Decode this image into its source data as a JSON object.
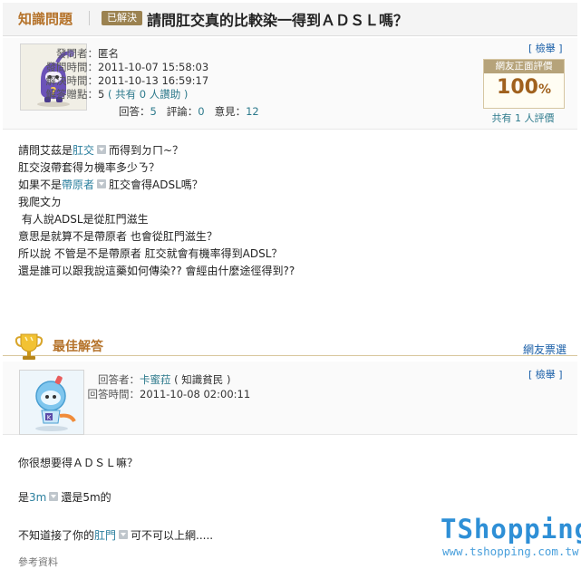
{
  "header": {
    "section": "知識問題",
    "status": "已解決",
    "title": "請問肛交真的比較染一得到ＡＤＳＬ嗎？"
  },
  "question_meta": {
    "asker_label": "發問者：",
    "asker": "匿名",
    "asked_label": "發問時間：",
    "asked": "2011-10-07 15:58:03",
    "solved_label": "解決時間：",
    "solved": "2011-10-13 16:59:17",
    "points_label": "解答贈點：",
    "points": "5",
    "points_note": "( 共有 0 人讚助 )",
    "answers_label": "回答：",
    "answers": "5",
    "comments_label": "評論：",
    "comments": "0",
    "opinions_label": "意見：",
    "opinions": "12",
    "report": "[ 檢舉 ]"
  },
  "rating": {
    "title": "網友正面評價",
    "value": "100",
    "unit": "%",
    "count_text": "共有 1 人評價"
  },
  "question_body": {
    "l1_pre": "請問艾茲是",
    "l1_kw": "肛交",
    "l1_post": "而得到ㄉㄇ~？",
    "l2": "肛交沒帶套得ㄉ機率多少ㄋ？",
    "l3_pre": "如果不是",
    "l3_kw": "帶原者",
    "l3_post": "肛交會得ADSL嗎？",
    "l4": "我爬文ㄉ",
    "l5": " 有人說ADSL是從肛門滋生",
    "l6": "意思是就算不是帶原者 也會從肛門滋生？",
    "l7": "所以說 不管是不是帶原者 肛交就會有機率得到ADSL？",
    "l8": "還是誰可以跟我說這藥如何傳染?? 會經由什麼途徑得到??"
  },
  "best_answer": {
    "heading": "最佳解答",
    "vote": "網友票選",
    "answerer_label": "回答者：",
    "answerer": "卡蜜菈",
    "answerer_level": "( 知識貧民 )",
    "time_label": "回答時間：",
    "time": "2011-10-08 02:00:11",
    "report": "[ 檢舉 ]",
    "b1": "你很想要得ＡＤＳＬ嘛？",
    "b2_pre": "是",
    "b2_kw": "3m",
    "b2_post": "還是5m的",
    "b3_pre": "不知道接了你的",
    "b3_kw": "肛門",
    "b3_post": "可不可以上網.....",
    "ref": "參考資料"
  },
  "watermark": {
    "logo": "TShopping",
    "url": "www.tshopping.com.tw"
  },
  "colors": {
    "accent": "#b5732b",
    "link": "#1a5fa8",
    "keyword": "#2b7f9e",
    "logo": "#2e8fd6"
  }
}
